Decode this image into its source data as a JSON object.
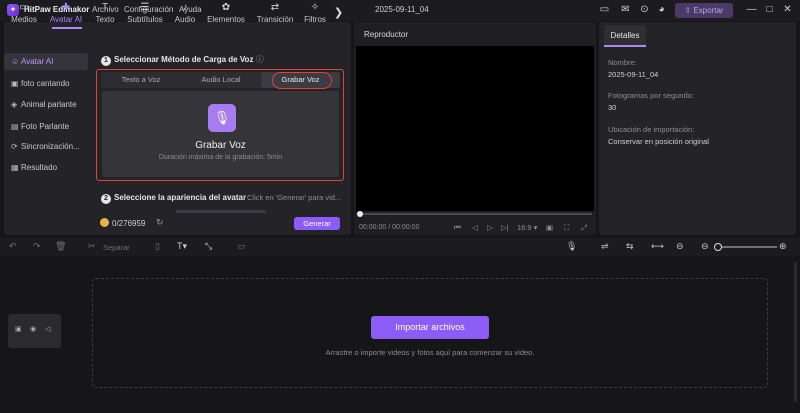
{
  "app": {
    "logo_glyph": "✦",
    "name": "HitPaw Edimakor",
    "menu": [
      "Archivo",
      "Configuración",
      "Ayuda"
    ],
    "project_name": "2025-09-11_04",
    "export_label": "Exportar"
  },
  "toolbar": {
    "tabs": [
      {
        "icon": "▭",
        "label": "Medios"
      },
      {
        "icon": "✚",
        "label": "Avatar AI"
      },
      {
        "icon": "T",
        "label": "Texto"
      },
      {
        "icon": "☰",
        "label": "Subtítulos"
      },
      {
        "icon": "♪",
        "label": "Audio"
      },
      {
        "icon": "✿",
        "label": "Elementos"
      },
      {
        "icon": "⇄",
        "label": "Transición"
      },
      {
        "icon": "✧",
        "label": "Filtros"
      }
    ],
    "active_tab": "Avatar AI",
    "more_glyph": "❯"
  },
  "sidebar": {
    "items": [
      {
        "icon": "☺",
        "label": "Avatar AI"
      },
      {
        "icon": "▣",
        "label": "foto cantando"
      },
      {
        "icon": "◈",
        "label": "Animal parlante"
      },
      {
        "icon": "▤",
        "label": "Foto Parlante"
      },
      {
        "icon": "⟳",
        "label": "Sincronización..."
      },
      {
        "icon": "▦",
        "label": "Resultado"
      }
    ]
  },
  "avatar": {
    "step1_num": "1",
    "step1_title": "Seleccionar Método de Carga de Voz",
    "info_glyph": "ⓘ",
    "upload_tabs": [
      "Texto a Voz",
      "Audio Local",
      "Grabar Voz"
    ],
    "active_upload_tab": "Grabar Voz",
    "mic_glyph": "🎙",
    "record_title": "Grabar Voz",
    "record_subtitle": "Duración máxima de la grabación: 5min",
    "step2_num": "2",
    "step2_title": "Seleccione la apariencia del avatar",
    "step2_hint": "Click en 'Generar' para vid...",
    "credits": "0/276959",
    "refresh_glyph": "↻",
    "generate_label": "Generar"
  },
  "player": {
    "title": "Reproductor",
    "timecode": "00:00:00 / 00:00:00",
    "ratio": "16:9 ▾",
    "controls": {
      "prev": "⏮",
      "back": "◁",
      "play": "▷",
      "fwd": "▷|",
      "snapshot": "▣",
      "fit": "⛶",
      "fullscreen": "⤢"
    }
  },
  "details": {
    "tab": "Detalles",
    "name_label": "Nombre:",
    "name_value": "2025-09-11_04",
    "fps_label": "Fotogramas por segundo:",
    "fps_value": "30",
    "import_label": "Ubicación de importación:",
    "import_value": "Conservar en posición original"
  },
  "timeline": {
    "split_label": "Separar",
    "tools": {
      "undo": "↶",
      "redo": "↷",
      "delete": "🗑",
      "cut": "✂",
      "copy": "▯",
      "text": "T▾",
      "crop": "⤡",
      "image": "▭",
      "mic": "🎙",
      "link": "⇌",
      "detach": "⇆",
      "snap": "⟷",
      "ripple": "⊖",
      "zoom_out": "⊖",
      "zoom_in": "⊕"
    },
    "track_icons": {
      "lock": "▣",
      "eye": "◉",
      "audio": "◁"
    },
    "import_label": "Importar archivos",
    "drop_hint": "Arrastre o importe videos y fotos aquí para comenzar su video."
  }
}
